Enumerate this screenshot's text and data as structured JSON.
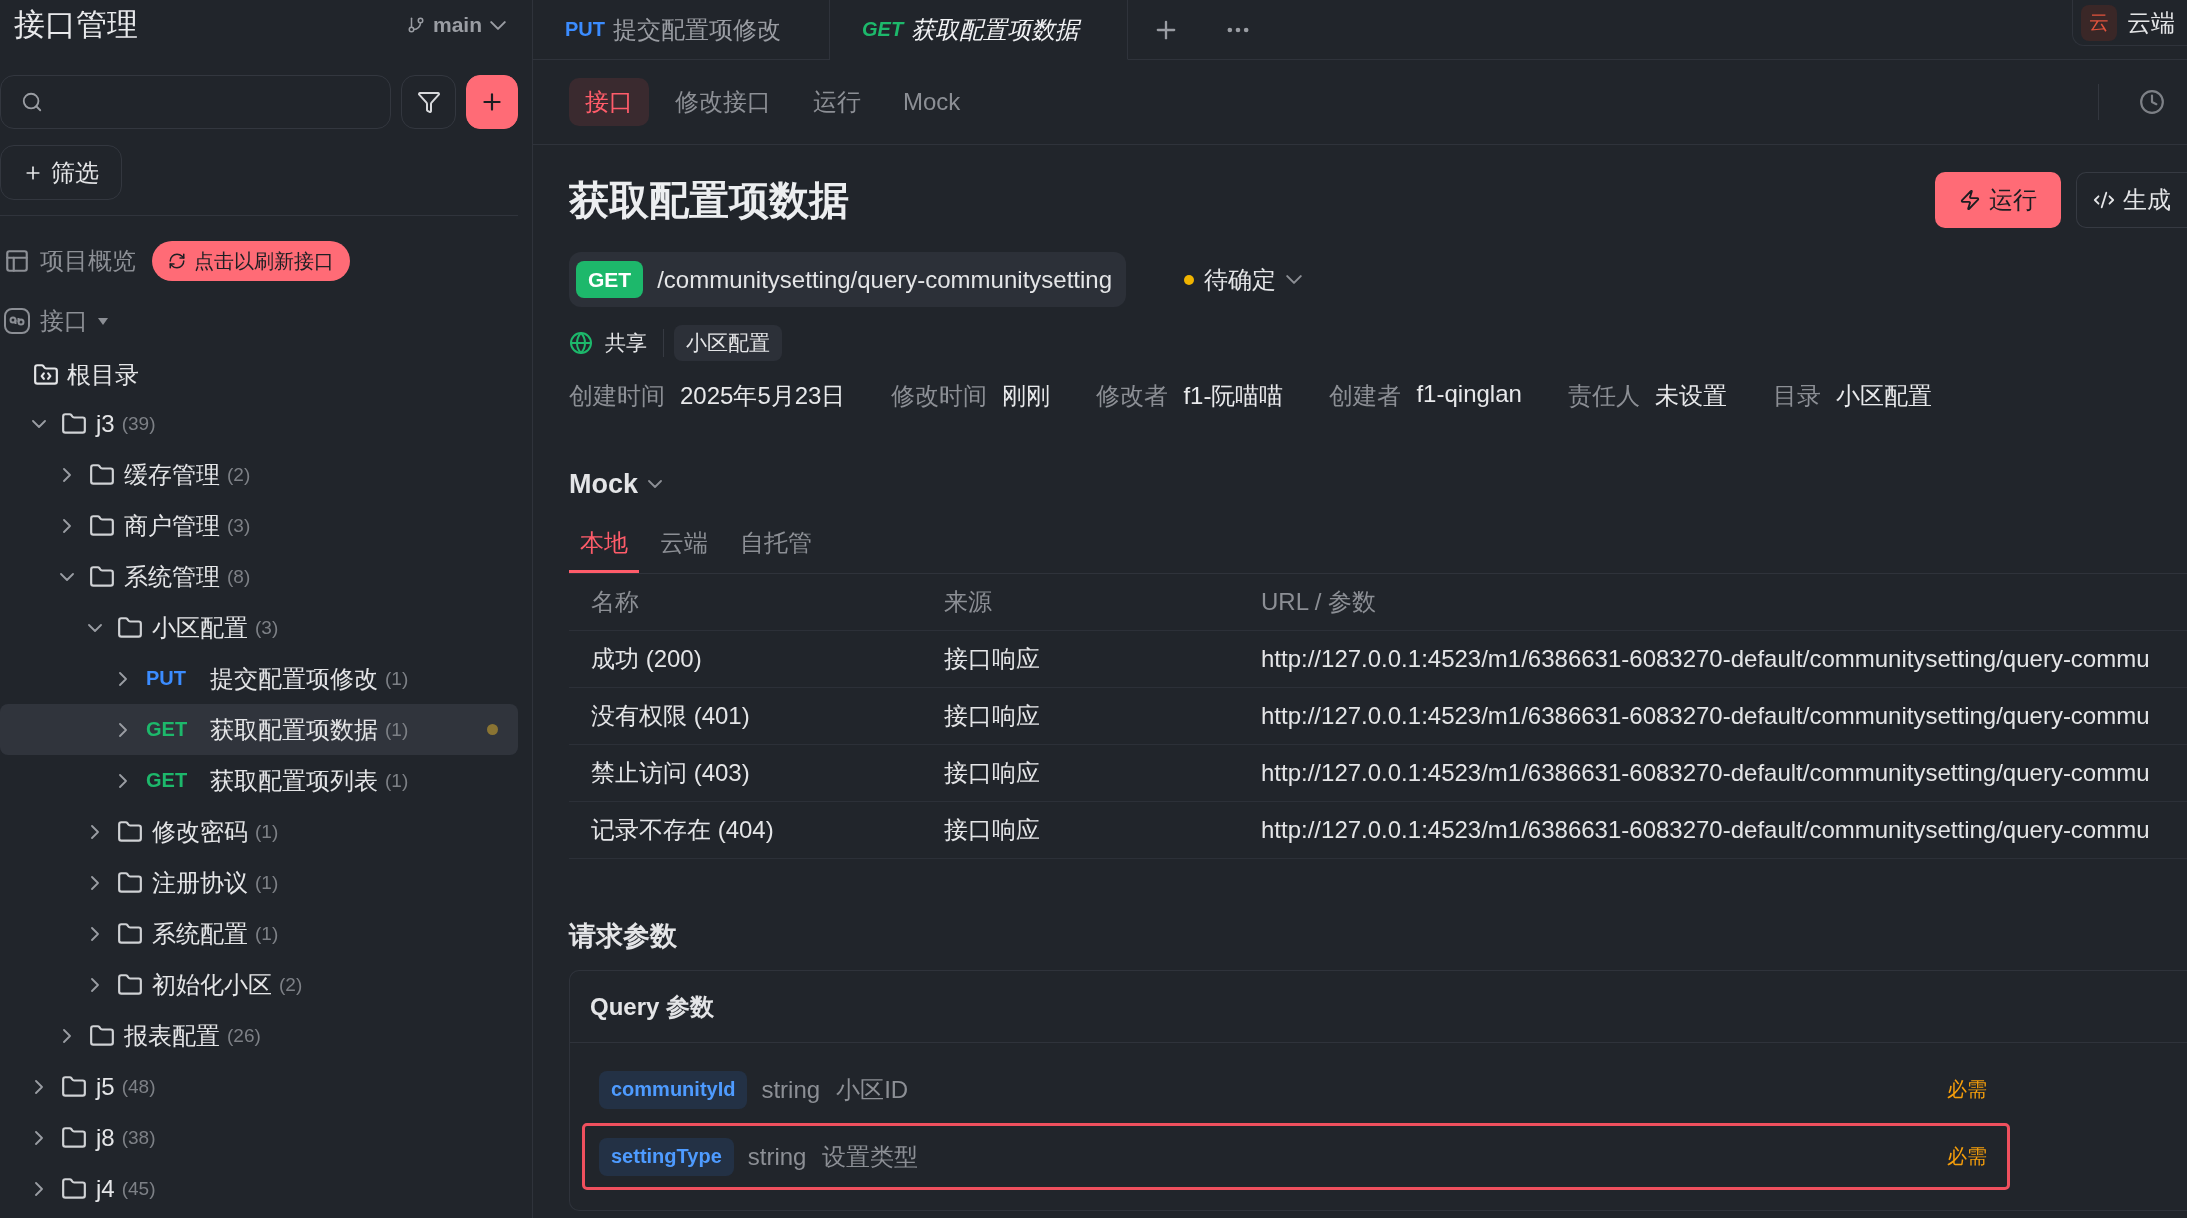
{
  "sidebar": {
    "title": "接口管理",
    "branch": "main",
    "filter_chip": "筛选",
    "overview": {
      "label": "项目概览",
      "refresh_button": "点击以刷新接口"
    },
    "section": "接口",
    "root": "根目录",
    "tree": [
      {
        "kind": "folder",
        "label": "j3",
        "count": "(39)",
        "expanded": true,
        "selected": false,
        "children": [
          {
            "kind": "folder",
            "label": "缓存管理",
            "count": "(2)",
            "expanded": false,
            "selected": false
          },
          {
            "kind": "folder",
            "label": "商户管理",
            "count": "(3)",
            "expanded": false,
            "selected": false
          },
          {
            "kind": "folder",
            "label": "系统管理",
            "count": "(8)",
            "expanded": true,
            "selected": false,
            "children": [
              {
                "kind": "folder",
                "label": "小区配置",
                "count": "(3)",
                "expanded": true,
                "selected": false,
                "children": [
                  {
                    "kind": "api",
                    "method": "PUT",
                    "label": "提交配置项修改",
                    "count": "(1)",
                    "expanded": false,
                    "selected": false,
                    "modified": false
                  },
                  {
                    "kind": "api",
                    "method": "GET",
                    "label": "获取配置项数据",
                    "count": "(1)",
                    "expanded": false,
                    "selected": true,
                    "modified": true
                  },
                  {
                    "kind": "api",
                    "method": "GET",
                    "label": "获取配置项列表",
                    "count": "(1)",
                    "expanded": false,
                    "selected": false,
                    "modified": false
                  }
                ]
              },
              {
                "kind": "folder",
                "label": "修改密码",
                "count": "(1)",
                "expanded": false,
                "selected": false
              },
              {
                "kind": "folder",
                "label": "注册协议",
                "count": "(1)",
                "expanded": false,
                "selected": false
              },
              {
                "kind": "folder",
                "label": "系统配置",
                "count": "(1)",
                "expanded": false,
                "selected": false
              },
              {
                "kind": "folder",
                "label": "初始化小区",
                "count": "(2)",
                "expanded": false,
                "selected": false
              }
            ]
          },
          {
            "kind": "folder",
            "label": "报表配置",
            "count": "(26)",
            "expanded": false,
            "selected": false
          }
        ]
      },
      {
        "kind": "folder",
        "label": "j5",
        "count": "(48)",
        "expanded": false,
        "selected": false
      },
      {
        "kind": "folder",
        "label": "j8",
        "count": "(38)",
        "expanded": false,
        "selected": false
      },
      {
        "kind": "folder",
        "label": "j4",
        "count": "(45)",
        "expanded": false,
        "selected": false
      }
    ]
  },
  "tabs": [
    {
      "method": "PUT",
      "label": "提交配置项修改",
      "selected": false,
      "preview": false
    },
    {
      "method": "GET",
      "label": "获取配置项数据",
      "selected": true,
      "preview": true
    }
  ],
  "cloud_button": {
    "badge": "云",
    "label": "云端"
  },
  "sub_tabs": [
    {
      "label": "接口",
      "selected": true
    },
    {
      "label": "修改接口",
      "selected": false
    },
    {
      "label": "运行",
      "selected": false
    },
    {
      "label": "Mock",
      "selected": false
    }
  ],
  "api": {
    "title": "获取配置项数据",
    "method": "GET",
    "path": "/communitysetting/query-communitysetting",
    "status": "待确定",
    "visibility": "共享",
    "tag": "小区配置",
    "meta": [
      {
        "label": "创建时间",
        "value": "2025年5月23日"
      },
      {
        "label": "修改时间",
        "value": "刚刚"
      },
      {
        "label": "修改者",
        "value": "f1-阮喵喵"
      },
      {
        "label": "创建者",
        "value": "f1-qinglan"
      },
      {
        "label": "责任人",
        "value": "未设置"
      },
      {
        "label": "目录",
        "value": "小区配置"
      }
    ],
    "run_button": "运行",
    "code_button": "生成"
  },
  "mock": {
    "title": "Mock",
    "tabs": [
      {
        "label": "本地",
        "selected": true
      },
      {
        "label": "云端",
        "selected": false
      },
      {
        "label": "自托管",
        "selected": false
      }
    ],
    "columns": [
      "名称",
      "来源",
      "URL / 参数"
    ],
    "rows": [
      [
        "成功 (200)",
        "接口响应",
        "http://127.0.0.1:4523/m1/6386631-6083270-default/communitysetting/query-commu"
      ],
      [
        "没有权限 (401)",
        "接口响应",
        "http://127.0.0.1:4523/m1/6386631-6083270-default/communitysetting/query-commu"
      ],
      [
        "禁止访问 (403)",
        "接口响应",
        "http://127.0.0.1:4523/m1/6386631-6083270-default/communitysetting/query-commu"
      ],
      [
        "记录不存在 (404)",
        "接口响应",
        "http://127.0.0.1:4523/m1/6386631-6083270-default/communitysetting/query-commu"
      ]
    ]
  },
  "request": {
    "title": "请求参数",
    "query": {
      "title": "Query 参数",
      "params": [
        {
          "name": "communityId",
          "type": "string",
          "description": "小区ID",
          "required": "必需",
          "highlighted": false
        },
        {
          "name": "settingType",
          "type": "string",
          "description": "设置类型",
          "required": "必需",
          "highlighted": true
        }
      ]
    }
  }
}
